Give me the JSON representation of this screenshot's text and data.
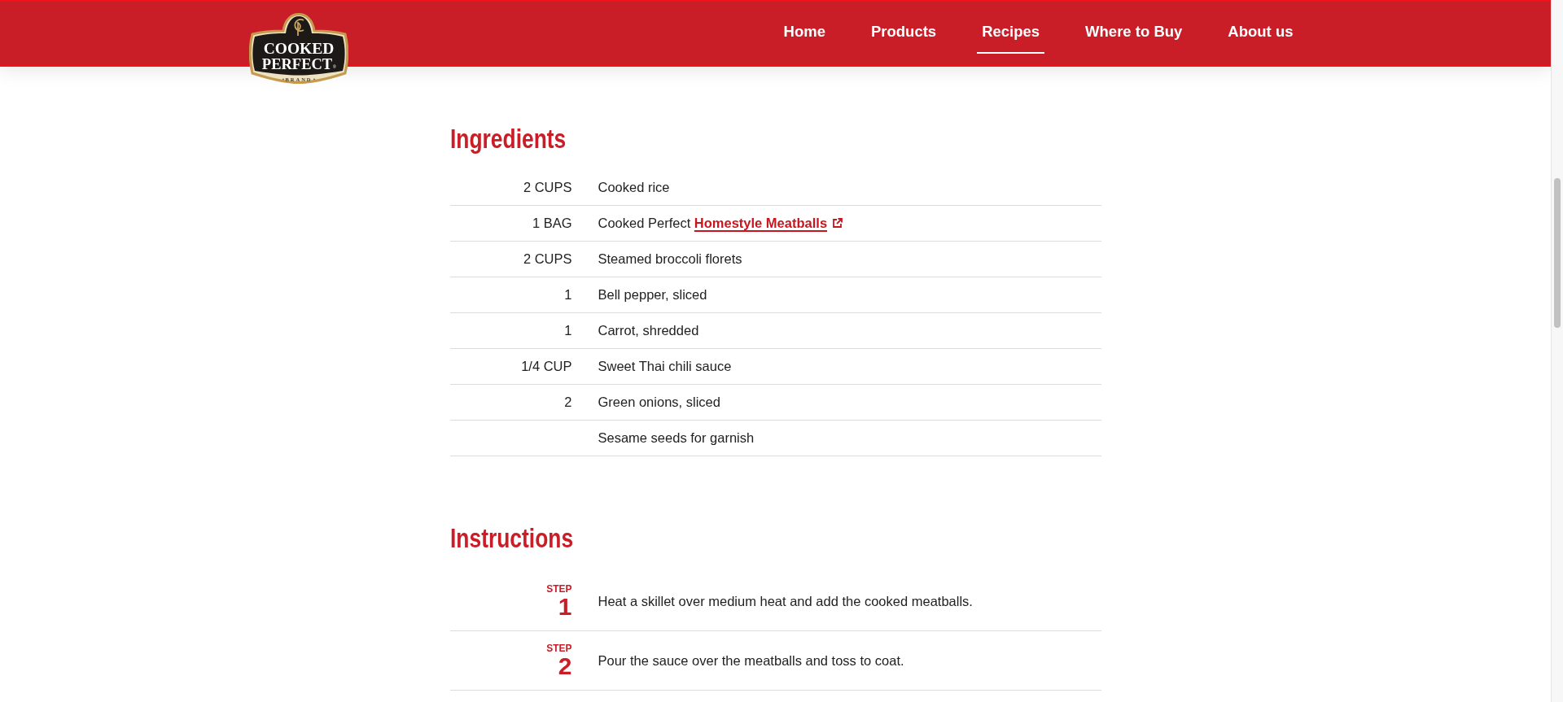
{
  "logo": {
    "wordmark": [
      "COOKED",
      "PERFECT"
    ],
    "registered": "®",
    "tagline": "BRAND"
  },
  "nav": [
    {
      "label": "Home",
      "selected": false
    },
    {
      "label": "Products",
      "selected": false
    },
    {
      "label": "Recipes",
      "selected": true
    },
    {
      "label": "Where to Buy",
      "selected": false
    },
    {
      "label": "About us",
      "selected": false
    }
  ],
  "ingredients": {
    "heading": "Ingredients",
    "items": [
      {
        "quantity": "2 CUPS",
        "name": "Cooked rice"
      },
      {
        "quantity": "1 BAG",
        "name": "Cooked Perfect",
        "link": "Homestyle Meatballs"
      },
      {
        "quantity": "2 CUPS",
        "name": "Steamed broccoli florets"
      },
      {
        "quantity": "1",
        "name": "Bell pepper, sliced"
      },
      {
        "quantity": "1",
        "name": "Carrot, shredded"
      },
      {
        "quantity": "1/4 CUP",
        "name": "Sweet Thai chili sauce"
      },
      {
        "quantity": "2",
        "name": "Green onions, sliced"
      },
      {
        "name": "Sesame seeds for garnish"
      }
    ]
  },
  "instructions": {
    "heading": "Instructions",
    "steps": [
      {
        "label": "STEP",
        "number": "1",
        "text": "Heat a skillet over medium heat and add the cooked meatballs."
      },
      {
        "label": "STEP",
        "number": "2",
        "text": "Pour the sauce over the meatballs and toss to coat."
      }
    ]
  }
}
